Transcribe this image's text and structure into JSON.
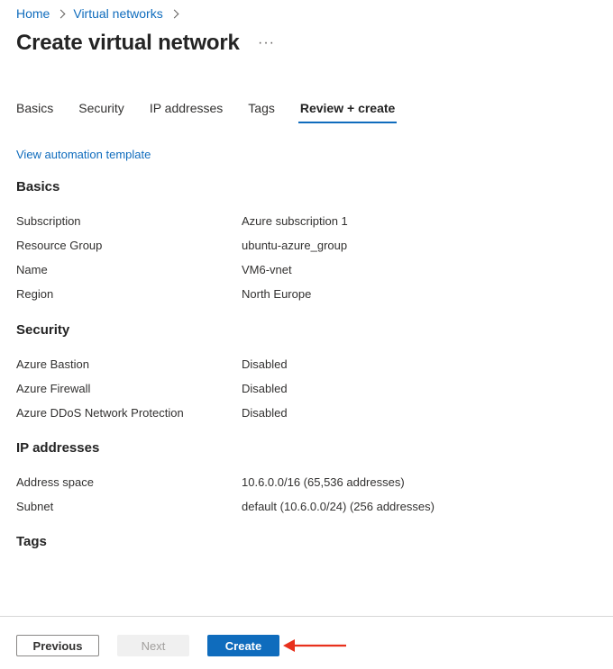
{
  "breadcrumb": {
    "home": "Home",
    "virtual_networks": "Virtual networks"
  },
  "header": {
    "title": "Create virtual network",
    "more": "···"
  },
  "tabs": [
    {
      "label": "Basics"
    },
    {
      "label": "Security"
    },
    {
      "label": "IP addresses"
    },
    {
      "label": "Tags"
    },
    {
      "label": "Review + create",
      "active": true
    }
  ],
  "automation_link": "View automation template",
  "sections": {
    "basics": {
      "title": "Basics",
      "rows": [
        {
          "label": "Subscription",
          "value": "Azure subscription 1"
        },
        {
          "label": "Resource Group",
          "value": "ubuntu-azure_group"
        },
        {
          "label": "Name",
          "value": "VM6-vnet"
        },
        {
          "label": "Region",
          "value": "North Europe"
        }
      ]
    },
    "security": {
      "title": "Security",
      "rows": [
        {
          "label": "Azure Bastion",
          "value": "Disabled"
        },
        {
          "label": "Azure Firewall",
          "value": "Disabled"
        },
        {
          "label": "Azure DDoS Network Protection",
          "value": "Disabled"
        }
      ]
    },
    "ip_addresses": {
      "title": "IP addresses",
      "rows": [
        {
          "label": "Address space",
          "value": "10.6.0.0/16 (65,536 addresses)"
        },
        {
          "label": "Subnet",
          "value": "default (10.6.0.0/24) (256 addresses)"
        }
      ]
    },
    "tags": {
      "title": "Tags"
    }
  },
  "footer": {
    "previous": "Previous",
    "next": "Next",
    "create": "Create"
  },
  "colors": {
    "accent": "#0f6cbd",
    "arrow": "#e8301c"
  }
}
